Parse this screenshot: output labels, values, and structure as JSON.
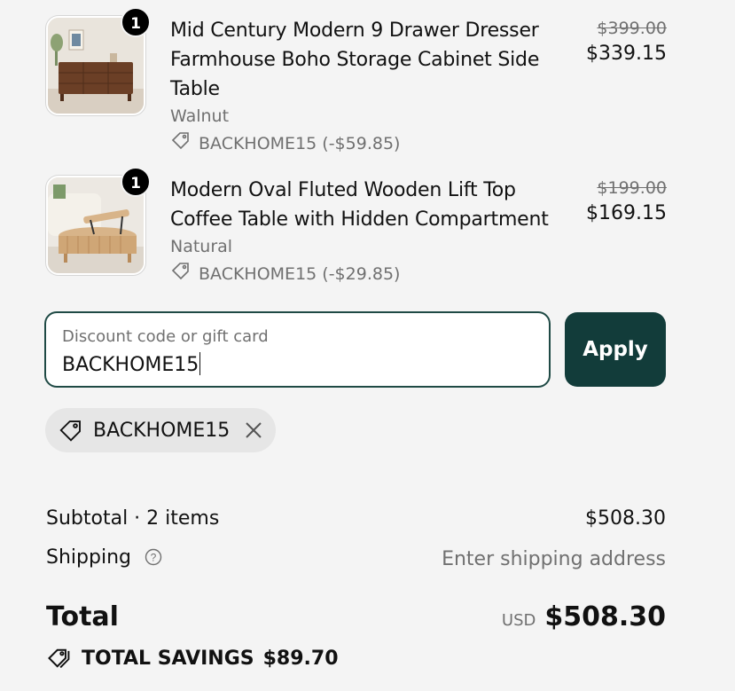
{
  "items": [
    {
      "quantity": "1",
      "title": "Mid Century Modern 9 Drawer Dresser Farmhouse Boho Storage Cabinet Side Table",
      "variant": "Walnut",
      "discount": "BACKHOME15 (-$59.85)",
      "original_price": "$399.00",
      "price": "$339.15"
    },
    {
      "quantity": "1",
      "title": "Modern Oval Fluted Wooden Lift Top Coffee Table with Hidden Compartment",
      "variant": "Natural",
      "discount": "BACKHOME15 (-$29.85)",
      "original_price": "$199.00",
      "price": "$169.15"
    }
  ],
  "discount_input": {
    "label": "Discount code or gift card",
    "value": "BACKHOME15"
  },
  "apply_label": "Apply",
  "applied_code": "BACKHOME15",
  "summary": {
    "subtotal_label": "Subtotal · 2 items",
    "subtotal_value": "$508.30",
    "shipping_label": "Shipping",
    "shipping_value": "Enter shipping address",
    "total_label": "Total",
    "currency": "USD",
    "total_value": "$508.30",
    "savings_label": "TOTAL SAVINGS",
    "savings_value": "$89.70"
  },
  "colors": {
    "accent": "#123c3a",
    "input_border": "#1f4a45",
    "muted_text": "#707070",
    "background": "#f4f4f4"
  },
  "icons": [
    "tag-icon",
    "close-icon",
    "help-icon",
    "tags-icon"
  ]
}
